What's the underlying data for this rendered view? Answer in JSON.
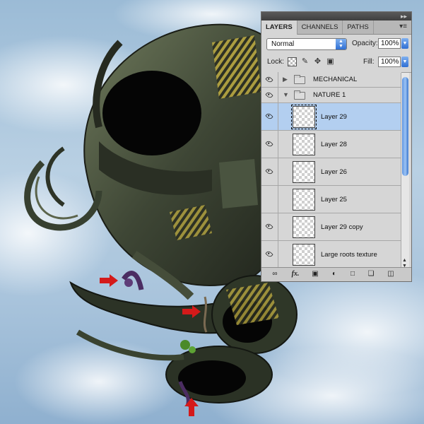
{
  "panel": {
    "collapse_icon": "double-chevron-right-icon",
    "tabs": [
      {
        "label": "LAYERS",
        "active": true
      },
      {
        "label": "CHANNELS",
        "active": false
      },
      {
        "label": "PATHS",
        "active": false
      }
    ],
    "menu_icon": "panel-menu-icon",
    "blend_mode": "Normal",
    "opacity_label": "Opacity:",
    "opacity_value": "100%",
    "lock_label": "Lock:",
    "fill_label": "Fill:",
    "fill_value": "100%",
    "layers": [
      {
        "type": "group",
        "name": "MECHANICAL",
        "expanded": false,
        "visible": true
      },
      {
        "type": "group",
        "name": "NATURE 1",
        "expanded": true,
        "visible": true
      },
      {
        "type": "layer",
        "name": "Layer 29",
        "visible": true,
        "selected": true
      },
      {
        "type": "layer",
        "name": "Layer 28",
        "visible": true,
        "selected": false
      },
      {
        "type": "layer",
        "name": "Layer 26",
        "visible": true,
        "selected": false
      },
      {
        "type": "layer",
        "name": "Layer 25",
        "visible": false,
        "selected": false
      },
      {
        "type": "layer",
        "name": "Layer 29 copy",
        "visible": true,
        "selected": false
      },
      {
        "type": "layer",
        "name": "Large roots texture",
        "visible": true,
        "selected": false
      }
    ],
    "bottom_icons": [
      "link-icon",
      "fx-icon",
      "mask-icon",
      "adjustment-icon",
      "folder-icon",
      "new-layer-icon",
      "trash-icon"
    ],
    "fx_label": "fx."
  },
  "colors": {
    "selection": "#b3cff0",
    "arrow": "#d41a1a",
    "sky": "#a9c4dc"
  }
}
